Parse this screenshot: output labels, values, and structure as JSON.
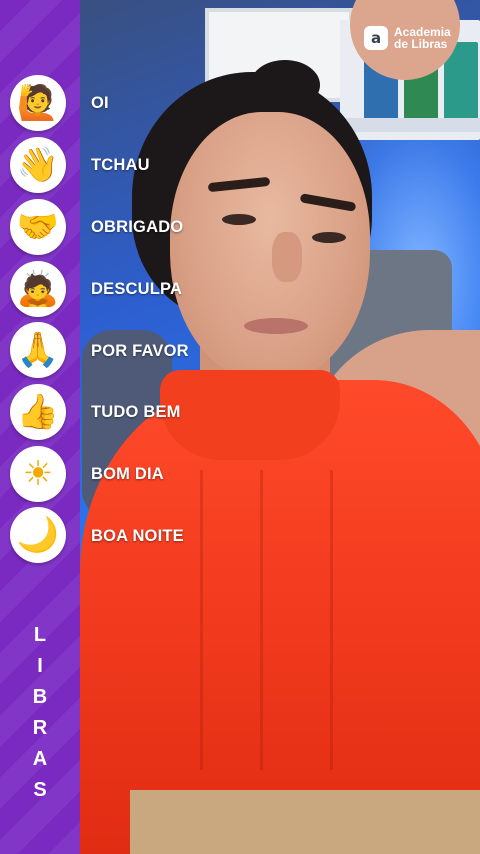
{
  "logo": {
    "mark": "a",
    "line1": "Academia",
    "line2": "de Libras"
  },
  "signs": [
    {
      "emoji": "🙋",
      "emoji_name": "raising-hand-icon",
      "label": "OI"
    },
    {
      "emoji": "👋",
      "emoji_name": "waving-hand-icon",
      "label": "TCHAU"
    },
    {
      "emoji": "🤝",
      "emoji_name": "handshake-icon",
      "label": "OBRIGADO"
    },
    {
      "emoji": "🙇",
      "emoji_name": "bowing-person-icon",
      "label": "DESCULPA"
    },
    {
      "emoji": "🙏",
      "emoji_name": "folded-hands-icon",
      "label": "POR FAVOR"
    },
    {
      "emoji": "👍",
      "emoji_name": "thumbs-up-icon",
      "label": "TUDO BEM"
    },
    {
      "emoji": "☀",
      "emoji_name": "sun-icon",
      "label": "BOM DIA"
    },
    {
      "emoji": "🌙",
      "emoji_name": "crescent-moon-icon",
      "label": "BOA NOITE"
    }
  ],
  "side_title": [
    "L",
    "I",
    "B",
    "R",
    "A",
    "S"
  ],
  "colors": {
    "panel": "#7a2ac0",
    "top": "#f13a1e"
  }
}
